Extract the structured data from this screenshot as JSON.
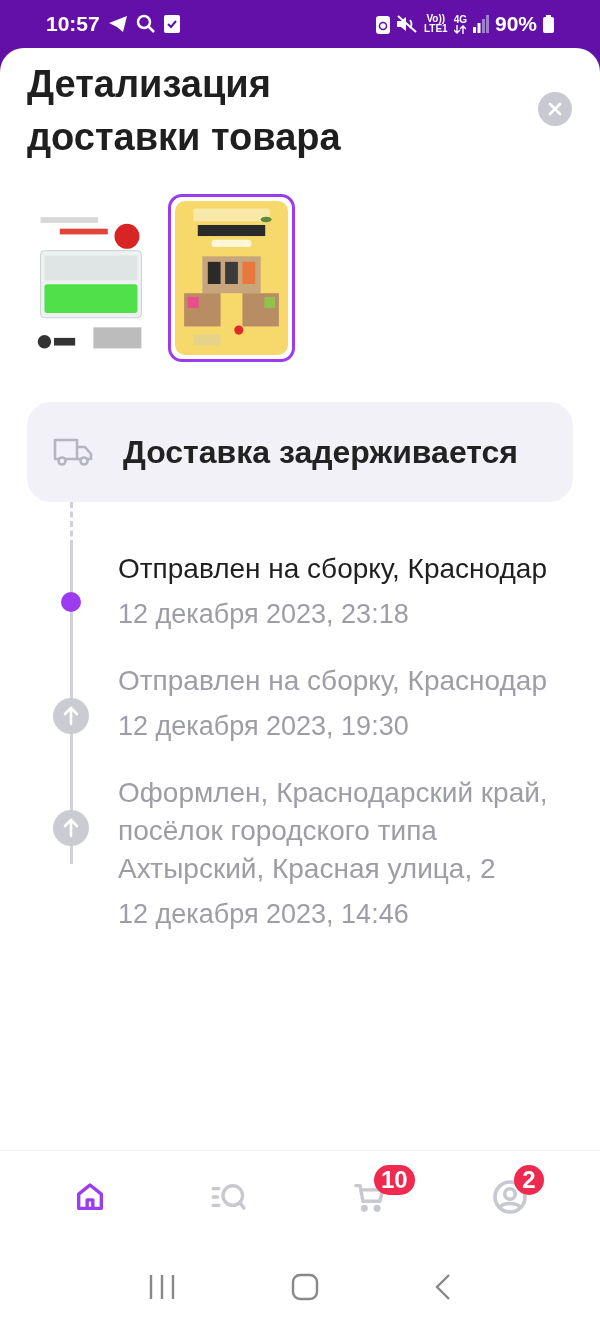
{
  "status_bar": {
    "time": "10:57",
    "volte": "Vo))",
    "lte": "LTE1",
    "network": "4G",
    "battery": "90%"
  },
  "sheet": {
    "title": "Детализация доставки товара"
  },
  "products": [
    {
      "kind": "picture",
      "selected": false
    },
    {
      "kind": "picture",
      "selected": true
    }
  ],
  "delivery_status": {
    "label": "Доставка задерживается"
  },
  "events": [
    {
      "title": "Отправлен на сборку, Краснодар",
      "date": "12 декабря 2023, 23:18",
      "current": true
    },
    {
      "title": "Отправлен на сборку, Краснодар",
      "date": "12 декабря 2023, 19:30",
      "current": false
    },
    {
      "title": "Оформлен, Краснодарский край, посёлок городского типа Ахтырский, Красная улица, 2",
      "date": "12 декабря 2023, 14:46",
      "current": false
    }
  ],
  "bottom_nav": [
    {
      "kind": "home",
      "selected": true
    },
    {
      "kind": "catalog",
      "selected": false
    },
    {
      "kind": "cart",
      "selected": false,
      "badge": "10"
    },
    {
      "kind": "profile",
      "selected": false,
      "badge": "2"
    }
  ]
}
